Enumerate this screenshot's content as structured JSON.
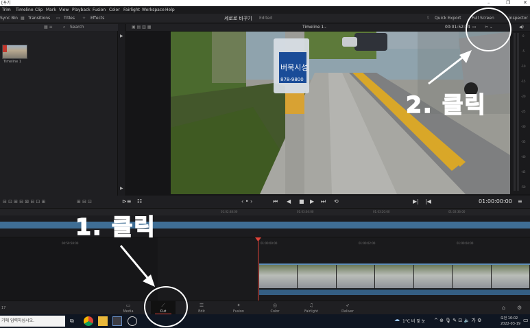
{
  "window": {
    "title_fragment": "[꾸기",
    "controls": [
      "–",
      "❐",
      "✕"
    ]
  },
  "menu": [
    "Trim",
    "Timeline",
    "Clip",
    "Mark",
    "View",
    "Playback",
    "Fusion",
    "Color",
    "Fairlight",
    "Workspace",
    "Help"
  ],
  "toolbar": {
    "left_items": [
      "Sync Bin",
      "Transitions",
      "Titles",
      "Effects"
    ],
    "project_title": "세로로 바꾸기",
    "project_status": "Edited",
    "right_items": [
      "Quick Export",
      "Full Screen",
      "Inspector"
    ]
  },
  "media_pool": {
    "search_label": "Search",
    "clip_label": "Timeline 1"
  },
  "viewer": {
    "timeline_name": "Timeline 1",
    "timecode_top": "00:01:52:14",
    "sign_text": "버묵시성",
    "sign_phone": "878-9800"
  },
  "meters": {
    "labels": [
      "0",
      "-5",
      "-10",
      "-15",
      "-20",
      "-25",
      "-30",
      "-35",
      "-40",
      "-45",
      "-50"
    ]
  },
  "transport": {
    "timecode": "01:00:00:00"
  },
  "timeline": {
    "ruler_upper": [
      "01:02:48:00",
      "01:03:04:00",
      "01:03:20:00",
      "01:03:36:00"
    ],
    "ruler_lower": [
      "00:59:58:00",
      "01:00:00:00",
      "01:00:02:00",
      "01:00:04:00"
    ]
  },
  "pages": [
    {
      "label": "Media",
      "icon": "media-icon"
    },
    {
      "label": "Cut",
      "icon": "cut-icon",
      "active": true
    },
    {
      "label": "Edit",
      "icon": "edit-icon"
    },
    {
      "label": "Fusion",
      "icon": "fusion-icon"
    },
    {
      "label": "Color",
      "icon": "color-icon"
    },
    {
      "label": "Fairlight",
      "icon": "fairlight-icon"
    },
    {
      "label": "Deliver",
      "icon": "deliver-icon"
    }
  ],
  "status_number": "17",
  "taskbar": {
    "search_placeholder": "기에 입력하십시오.",
    "weather": "1°C 비 및 눈",
    "time": "오전 10:02",
    "date": "2022-03-19"
  },
  "annotations": {
    "step1": "1. 클릭",
    "step2": "2. 클릭"
  },
  "colors": {
    "accent_red": "#e0443a",
    "track_blue": "#3f6e95",
    "annotation": "#ffffff"
  }
}
